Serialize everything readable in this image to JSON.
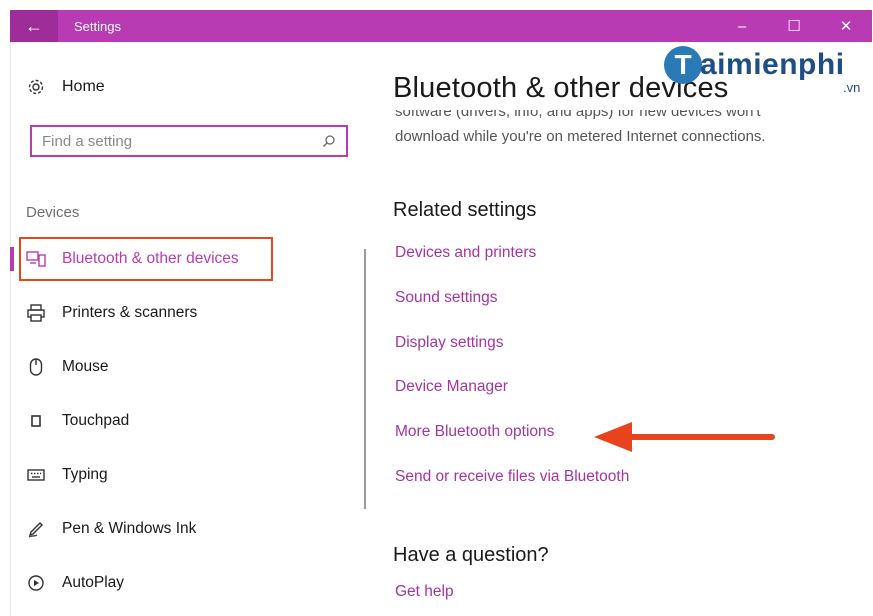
{
  "window": {
    "back_label": "←",
    "title": "Settings",
    "minimize": "–",
    "maximize": "☐",
    "close": "✕"
  },
  "sidebar": {
    "home_label": "Home",
    "search_placeholder": "Find a setting",
    "section_label": "Devices",
    "items": [
      {
        "label": "Bluetooth & other devices",
        "icon": "bluetooth-devices-icon",
        "active": true
      },
      {
        "label": "Printers & scanners",
        "icon": "printer-icon"
      },
      {
        "label": "Mouse",
        "icon": "mouse-icon"
      },
      {
        "label": "Touchpad",
        "icon": "touchpad-icon"
      },
      {
        "label": "Typing",
        "icon": "keyboard-icon"
      },
      {
        "label": "Pen & Windows Ink",
        "icon": "pen-icon"
      },
      {
        "label": "AutoPlay",
        "icon": "autoplay-icon"
      }
    ]
  },
  "main": {
    "page_title": "Bluetooth & other devices",
    "cut_line": "software (drivers, info, and apps) for new devices won't",
    "desc_line": "download while you're on metered Internet connections.",
    "related_title": "Related settings",
    "links": [
      "Devices and printers",
      "Sound settings",
      "Display settings",
      "Device Manager",
      "More Bluetooth options",
      "Send or receive files via Bluetooth"
    ],
    "question_title": "Have a question?",
    "help_link": "Get help"
  },
  "watermark": {
    "badge": "T",
    "text": "aimienphi",
    "tld": ".vn"
  },
  "colors": {
    "accent": "#b83bb3",
    "highlight_box": "#e04a1a",
    "arrow": "#e8431c",
    "link": "#a335a0"
  }
}
